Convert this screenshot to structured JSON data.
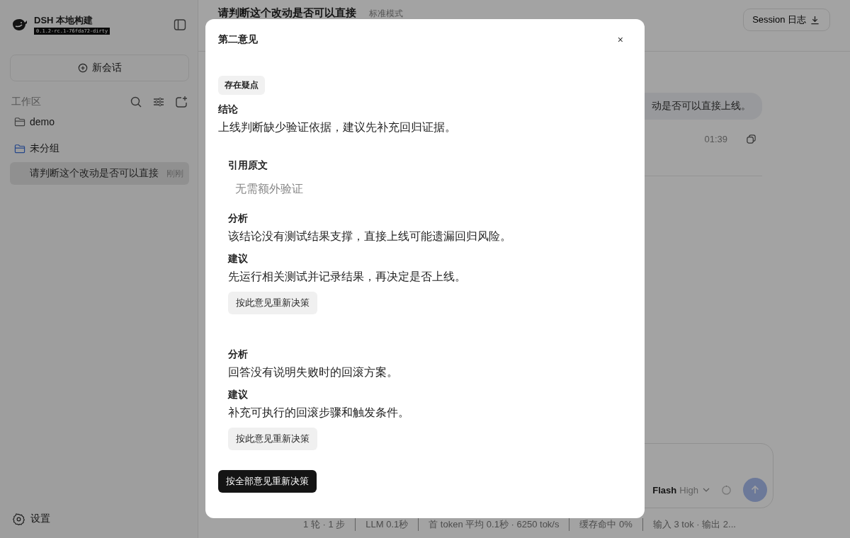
{
  "sidebar": {
    "app_name": "DSH 本地构建",
    "version": "0.1.2-rc.1-76fda72-dirty",
    "new_chat": "新会话",
    "workspace_label": "工作区",
    "folders": [
      {
        "name": "demo",
        "selected": false
      },
      {
        "name": "未分组",
        "selected": true,
        "children": [
          {
            "title": "请判断这个改动是否可以直接",
            "time": "刚刚",
            "selected": true
          }
        ]
      }
    ],
    "settings": "设置"
  },
  "header": {
    "title": "请判断这个改动是否可以直接",
    "mode": "标准模式",
    "session_log": "Session 日志"
  },
  "messages": [
    {
      "text": "动是否可以直接上线。",
      "time": "01:39"
    }
  ],
  "composer": {
    "model": "Flash",
    "effort": "High"
  },
  "status_bar": [
    "1 轮 · 1 步",
    "LLM 0.1秒",
    "首 token 平均 0.1秒 · 6250 tok/s",
    "缓存命中 0%",
    "输入 3 tok · 输出 2..."
  ],
  "dialog": {
    "title": "第二意见",
    "close": "×",
    "verdict_badge": "存在疑点",
    "conclusion_label": "结论",
    "conclusion": "上线判断缺少验证依据，建议先补充回归证据。",
    "findings": [
      {
        "quote_label": "引用原文",
        "quote": "无需额外验证",
        "analysis_label": "分析",
        "analysis": "该结论没有测试结果支撑，直接上线可能遗漏回归风险。",
        "suggestion_label": "建议",
        "suggestion": "先运行相关测试并记录结果，再决定是否上线。",
        "action": "按此意见重新决策"
      },
      {
        "analysis_label": "分析",
        "analysis": "回答没有说明失败时的回滚方案。",
        "suggestion_label": "建议",
        "suggestion": "补充可执行的回滚步骤和触发条件。",
        "action": "按此意见重新决策"
      }
    ],
    "apply_all": "按全部意见重新决策"
  }
}
